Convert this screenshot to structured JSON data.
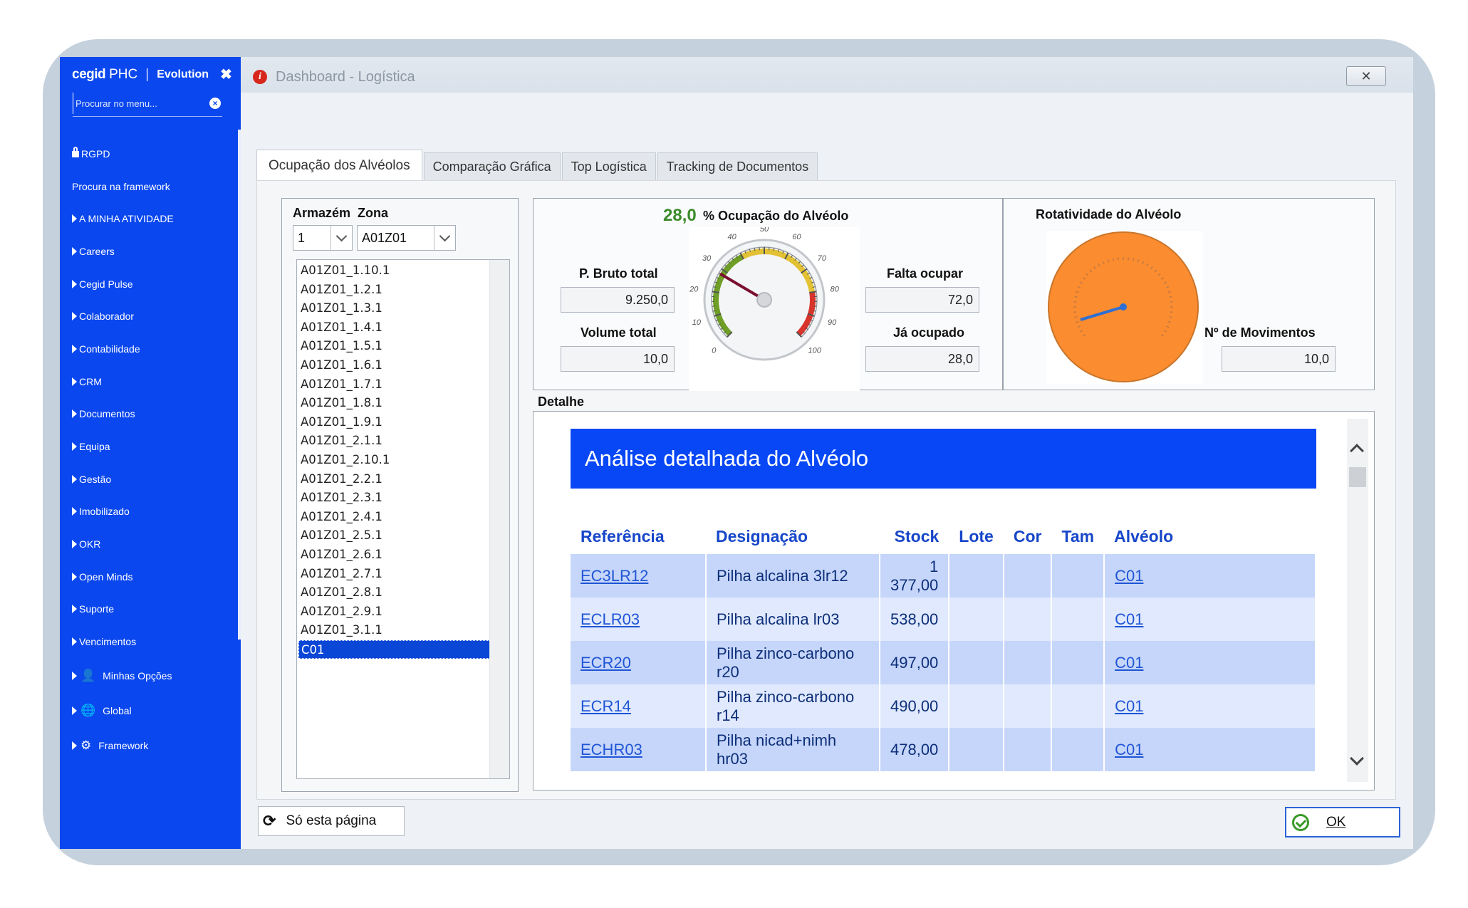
{
  "sidebar": {
    "brand_main": "cegid",
    "brand_product": "PHC",
    "brand_edition": "Evolution",
    "search_placeholder": "Procurar no menu...",
    "items": [
      {
        "label": "RGPD",
        "icon": "lock-icon"
      },
      {
        "label": "Procura na framework"
      },
      {
        "label": "A MINHA ATIVIDADE"
      },
      {
        "label": "Careers"
      },
      {
        "label": "Cegid Pulse"
      },
      {
        "label": "Colaborador"
      },
      {
        "label": "Contabilidade"
      },
      {
        "label": "CRM"
      },
      {
        "label": "Documentos"
      },
      {
        "label": "Equipa"
      },
      {
        "label": "Gestão"
      },
      {
        "label": "Imobilizado"
      },
      {
        "label": "OKR"
      },
      {
        "label": "Open Minds"
      },
      {
        "label": "Suporte"
      },
      {
        "label": "Vencimentos"
      }
    ],
    "extra_items": [
      {
        "label": "Minhas Opções",
        "icon": "user-icon"
      },
      {
        "label": "Global",
        "icon": "globe-icon"
      },
      {
        "label": "Framework",
        "icon": "gears-icon"
      }
    ]
  },
  "window": {
    "title": "Dashboard - Logística",
    "close_label": "✕"
  },
  "tabs": [
    {
      "label": "Ocupação dos Alvéolos",
      "active": true
    },
    {
      "label": "Comparação Gráfica"
    },
    {
      "label": "Top Logística"
    },
    {
      "label": "Tracking de Documentos"
    }
  ],
  "filters": {
    "armazem_label": "Armazém",
    "armazem_value": "1",
    "zona_label": "Zona",
    "zona_value": "A01Z01"
  },
  "list": [
    "A01Z01_1.10.1",
    "A01Z01_1.2.1",
    "A01Z01_1.3.1",
    "A01Z01_1.4.1",
    "A01Z01_1.5.1",
    "A01Z01_1.6.1",
    "A01Z01_1.7.1",
    "A01Z01_1.8.1",
    "A01Z01_1.9.1",
    "A01Z01_2.1.1",
    "A01Z01_2.10.1",
    "A01Z01_2.2.1",
    "A01Z01_2.3.1",
    "A01Z01_2.4.1",
    "A01Z01_2.5.1",
    "A01Z01_2.6.1",
    "A01Z01_2.7.1",
    "A01Z01_2.8.1",
    "A01Z01_2.9.1",
    "A01Z01_3.1.1",
    "C01"
  ],
  "occupation": {
    "value": "28,0",
    "title": "% Ocupação do Alvéolo",
    "gauge_value": 28,
    "gauge_ticks": [
      "0",
      "10",
      "20",
      "30",
      "40",
      "50",
      "60",
      "70",
      "80",
      "90",
      "100"
    ],
    "p_bruto_label": "P. Bruto total",
    "p_bruto_value": "9.250,0",
    "volume_label": "Volume total",
    "volume_value": "10,0",
    "falta_label": "Falta ocupar",
    "falta_value": "72,0",
    "ja_label": "Já ocupado",
    "ja_value": "28,0"
  },
  "rotation": {
    "title": "Rotatividade do Alvéolo",
    "mov_label": "Nº de Movimentos",
    "mov_value": "10,0",
    "dial_color": "#fb8c2f"
  },
  "detail": {
    "label": "Detalhe",
    "banner": "Análise detalhada do Alvéolo",
    "headers": [
      "Referência",
      "Designação",
      "Stock",
      "Lote",
      "Cor",
      "Tam",
      "Alvéolo"
    ],
    "rows": [
      [
        "EC3LR12",
        "Pilha alcalina 3lr12",
        "1 377,00",
        "",
        "",
        "",
        "C01"
      ],
      [
        "ECLR03",
        "Pilha alcalina lr03",
        "538,00",
        "",
        "",
        "",
        "C01"
      ],
      [
        "ECR20",
        "Pilha zinco-carbono r20",
        "497,00",
        "",
        "",
        "",
        "C01"
      ],
      [
        "ECR14",
        "Pilha zinco-carbono r14",
        "490,00",
        "",
        "",
        "",
        "C01"
      ],
      [
        "ECHR03",
        "Pilha nicad+nimh hr03",
        "478,00",
        "",
        "",
        "",
        "C01"
      ]
    ]
  },
  "buttons": {
    "page_label": "Só esta página",
    "ok_label": "OK"
  },
  "colors": {
    "sidebar": "#0a47ee",
    "accent_green": "#3b8a2a",
    "banner": "#0747f5"
  }
}
